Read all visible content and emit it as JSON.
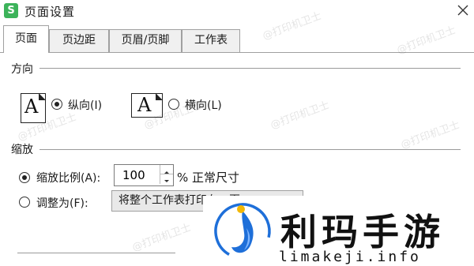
{
  "dialog": {
    "title": "页面设置",
    "app_icon_letter": "S"
  },
  "tabs": [
    {
      "label": "页面",
      "active": true
    },
    {
      "label": "页边距",
      "active": false
    },
    {
      "label": "页眉/页脚",
      "active": false
    },
    {
      "label": "工作表",
      "active": false
    }
  ],
  "orientation": {
    "section_label": "方向",
    "portrait": {
      "label": "纵向(I)",
      "checked": true
    },
    "landscape": {
      "label": "横向(L)",
      "checked": false
    },
    "page_glyph": "A"
  },
  "scaling": {
    "section_label": "缩放",
    "scale_ratio": {
      "label": "缩放比例(A):",
      "checked": true,
      "value": "100",
      "suffix": "% 正常尺寸"
    },
    "fit_to": {
      "label": "调整为(F):",
      "checked": false,
      "value": "将整个工作表打印在一页"
    }
  },
  "watermark": {
    "text": "@打印机卫士"
  },
  "overlay_brand": {
    "name": "利玛手游",
    "url": "limakeji.info"
  },
  "colors": {
    "app_icon": "#3cb35a",
    "brand_blue": "#1e6fd9",
    "brand_yellow": "#f2b705"
  }
}
